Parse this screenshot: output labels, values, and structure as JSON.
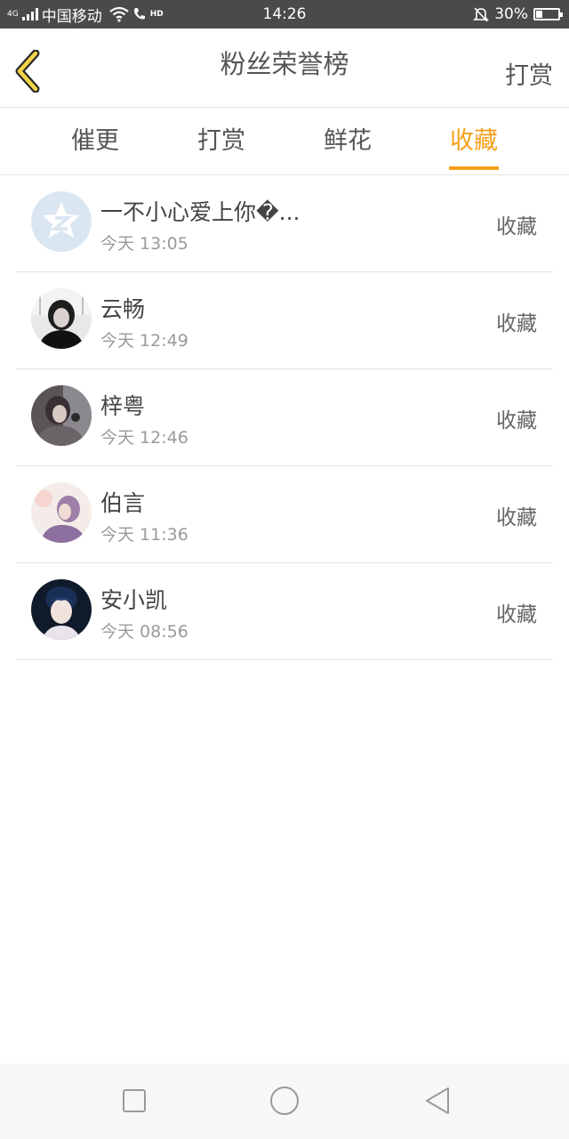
{
  "status_bar": {
    "network_tag": "4G",
    "carrier": "中国移动",
    "hd_tag": "HD",
    "time": "14:26",
    "battery_text": "30%",
    "battery_level": 0.3
  },
  "header": {
    "title": "粉丝荣誉榜",
    "action": "打赏",
    "accent": "#f5a01a"
  },
  "tabs": [
    {
      "label": "催更",
      "active": false
    },
    {
      "label": "打赏",
      "active": false
    },
    {
      "label": "鲜花",
      "active": false
    },
    {
      "label": "收藏",
      "active": true
    }
  ],
  "fans": [
    {
      "name": "一不小心爱上你�...",
      "time": "今天 13:05",
      "action": "收藏",
      "avatar": "qq-default-avatar"
    },
    {
      "name": "云畅",
      "time": "今天 12:49",
      "action": "收藏",
      "avatar": "user-photo-avatar"
    },
    {
      "name": "梓粤",
      "time": "今天 12:46",
      "action": "收藏",
      "avatar": "user-photo-avatar"
    },
    {
      "name": "伯言",
      "time": "今天 11:36",
      "action": "收藏",
      "avatar": "user-photo-avatar"
    },
    {
      "name": "安小凯",
      "time": "今天 08:56",
      "action": "收藏",
      "avatar": "user-photo-avatar"
    }
  ],
  "nav_bar": {
    "buttons": [
      "recent-apps-icon",
      "home-icon",
      "back-triangle-icon"
    ]
  }
}
